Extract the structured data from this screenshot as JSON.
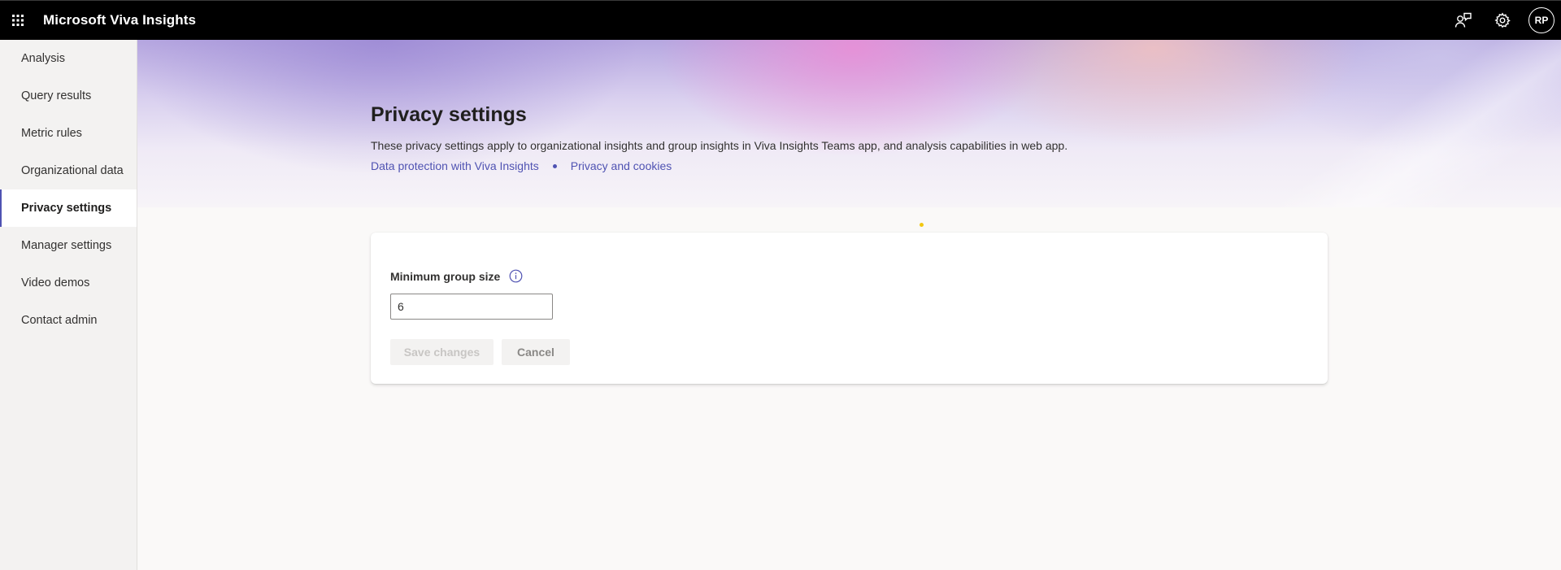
{
  "app": {
    "title": "Microsoft Viva Insights"
  },
  "topbar": {
    "waffle_icon": "app-launcher-icon",
    "feedback_icon": "feedback-icon",
    "settings_icon": "gear-icon",
    "avatar_initials": "RP"
  },
  "sidebar": {
    "items": [
      {
        "label": "Analysis"
      },
      {
        "label": "Query results"
      },
      {
        "label": "Metric rules"
      },
      {
        "label": "Organizational data"
      },
      {
        "label": "Privacy settings",
        "active": true
      },
      {
        "label": "Manager settings"
      },
      {
        "label": "Video demos"
      },
      {
        "label": "Contact admin"
      }
    ]
  },
  "header": {
    "title": "Privacy settings",
    "description": "These privacy settings apply to organizational insights and group insights in Viva Insights Teams app, and analysis capabilities in web app.",
    "links": [
      {
        "label": "Data protection with Viva Insights"
      },
      {
        "label": "Privacy and cookies"
      }
    ]
  },
  "form": {
    "min_group_size_label": "Minimum group size",
    "min_group_size_value": "6",
    "save_label": "Save changes",
    "cancel_label": "Cancel"
  },
  "colors": {
    "accent": "#4f52b2",
    "topbar": "#000000",
    "sidebar": "#f3f2f1",
    "loading_dot": "#f2c811"
  }
}
